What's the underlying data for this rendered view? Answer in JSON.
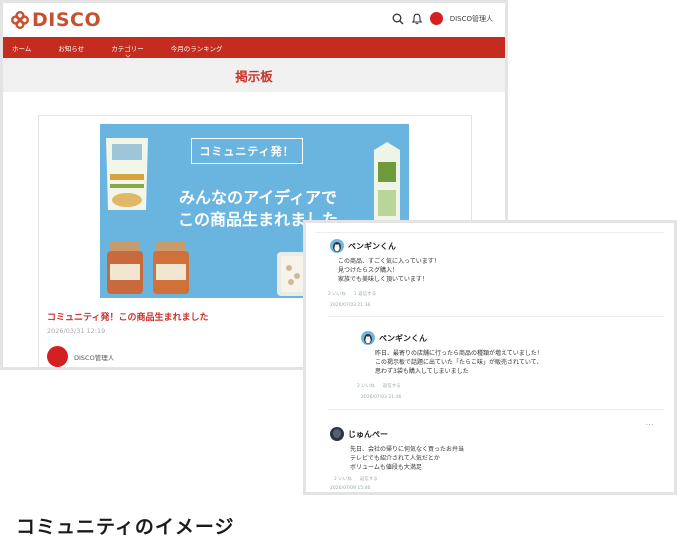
{
  "app": {
    "logo_text": "DISCO",
    "user_name": "DISCO管理人",
    "brand_color": "#c32c1f",
    "icons": [
      "search-icon",
      "bell-icon"
    ]
  },
  "nav": {
    "items": [
      {
        "label": "ホーム"
      },
      {
        "label": "お知らせ"
      },
      {
        "label": "カテゴリー"
      },
      {
        "label": "今月のランキング"
      }
    ]
  },
  "page": {
    "title": "掲示板"
  },
  "post": {
    "banner": {
      "badge": "コミュニティ発！",
      "line1": "みんなのアイディアで",
      "line2": "この商品生まれました"
    },
    "title": "コミュニティ発！この商品生まれました",
    "date": "2026/03/31 12:19",
    "author": "DISCO管理人"
  },
  "comments": [
    {
      "name": "ペンギンくん",
      "lines": [
        "この商品、すごく気に入っています！",
        "見つけたらスグ購入！",
        "家族でも美味しく頂いています！"
      ],
      "likes": "2 いいね",
      "replies": "1 返信する",
      "date": "2026/07/03 21:36"
    },
    {
      "name": "ペンギンくん",
      "lines": [
        "昨日、最寄りの店舗に行ったら商品の種類が増えていました！",
        "この掲示板で話題に出ていた「たらこ味」が販売されていて、",
        "思わず3袋も購入してしまいました"
      ],
      "likes": "2 いいね",
      "replies": "返信する",
      "date": "2026/07/03 21:36"
    },
    {
      "name": "じゅんぺー",
      "lines": [
        "先日、会社の帰りに何気なく買ったお弁当",
        "テレビでも紹介されて人気だとか",
        "ボリュームも値段も大満足"
      ],
      "likes": "2 いいね",
      "replies": "返信する",
      "date": "2026/07/09 15:46"
    }
  ],
  "caption": "コミュニティのイメージ"
}
